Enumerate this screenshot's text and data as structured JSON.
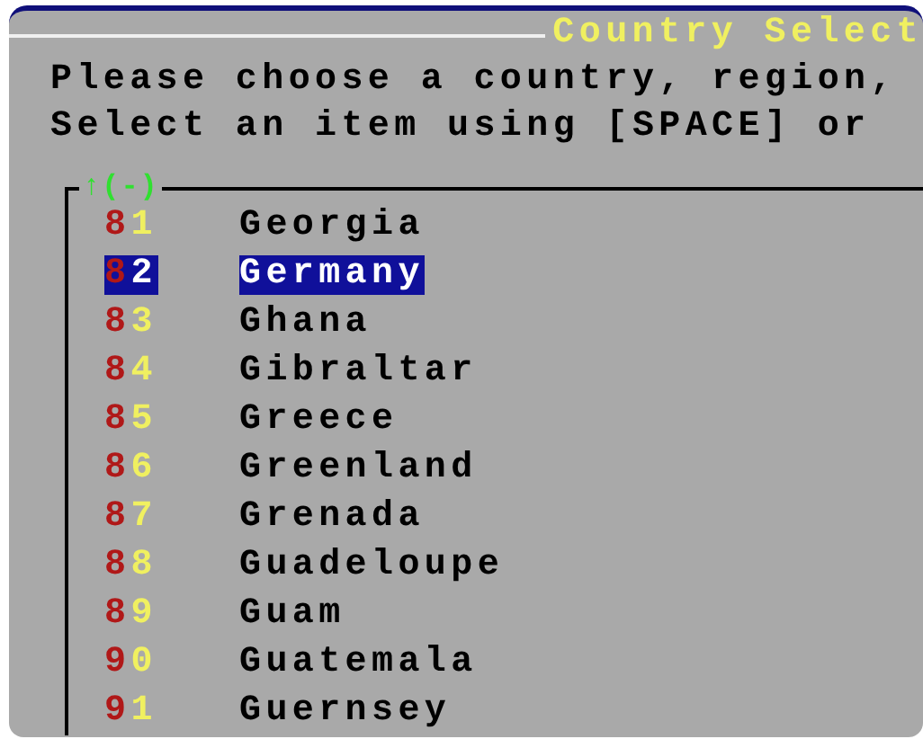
{
  "dialog": {
    "title": "Country Select",
    "prompt_lines": [
      "Please choose a country, region,",
      "Select an item using [SPACE] or"
    ],
    "list": {
      "scroll_indicator": "↑(-)",
      "items": [
        {
          "tag": "81",
          "label": "Georgia",
          "selected": false
        },
        {
          "tag": "82",
          "label": "Germany",
          "selected": true
        },
        {
          "tag": "83",
          "label": "Ghana",
          "selected": false
        },
        {
          "tag": "84",
          "label": "Gibraltar",
          "selected": false
        },
        {
          "tag": "85",
          "label": "Greece",
          "selected": false
        },
        {
          "tag": "86",
          "label": "Greenland",
          "selected": false
        },
        {
          "tag": "87",
          "label": "Grenada",
          "selected": false
        },
        {
          "tag": "88",
          "label": "Guadeloupe",
          "selected": false
        },
        {
          "tag": "89",
          "label": "Guam",
          "selected": false
        },
        {
          "tag": "90",
          "label": "Guatemala",
          "selected": false
        },
        {
          "tag": "91",
          "label": "Guernsey",
          "selected": false
        }
      ]
    }
  }
}
